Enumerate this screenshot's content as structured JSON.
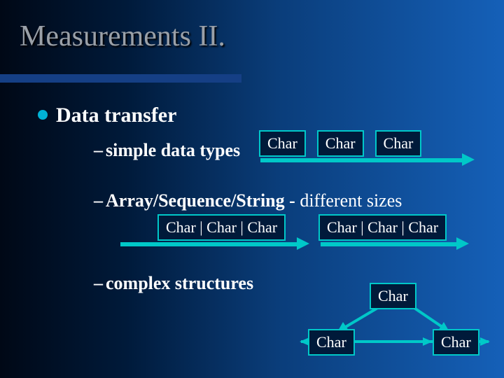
{
  "title": "Measurements II.",
  "bullets": {
    "lvl1": "Data transfer",
    "simple": "simple data types",
    "arrayseq_bold": "Array/Sequence/String - ",
    "arrayseq_rest": "different sizes",
    "complex": "complex structures"
  },
  "boxes": {
    "char": "Char",
    "char3": "Char | Char | Char"
  }
}
